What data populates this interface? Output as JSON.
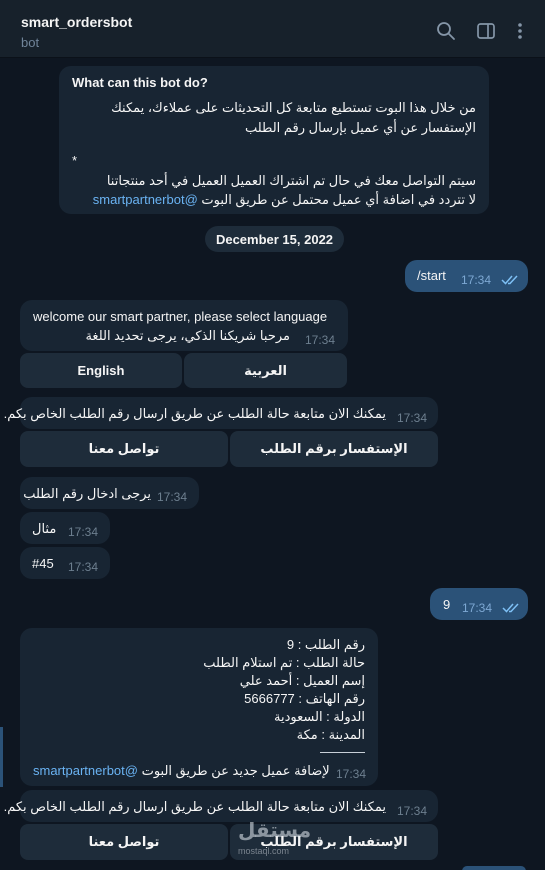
{
  "header": {
    "title": "smart_ordersbot",
    "subtitle": "bot"
  },
  "intro": {
    "heading": "What can this bot do?",
    "line1": "من خلال هذا البوت تستطيع متابعة كل التحديثات على عملاءك، يمكنك",
    "line2": "الإستفسار عن أي عميل بإرسال رقم الطلب",
    "bullet": "*",
    "line3": "سيتم التواصل معك في حال تم اشتراك العميل العميل في أحد منتجاتنا",
    "line4_prefix": "لا تتردد في اضافة أي عميل محتمل عن طريق البوت",
    "line4_link": "@smartpartnerbot"
  },
  "date_separator": "December 15, 2022",
  "messages": {
    "start": {
      "text": "/start",
      "time": "17:34"
    },
    "welcome": {
      "en": "welcome our smart partner, please select language",
      "ar": "مرحبا شريكنا الذكي، يرجى تحديد اللغة",
      "time": "17:34"
    },
    "lang_buttons": {
      "english": "English",
      "arabic": "العربية"
    },
    "follow1": {
      "text": "يمكنك الان متابعة حالة الطلب عن طريق ارسال رقم الطلب الخاص بكم.",
      "time": "17:34"
    },
    "menu1": {
      "contact": "تواصل معنا",
      "inquiry": "الإستفسار برقم الطلب"
    },
    "enter_order": {
      "text": "يرجى ادخال رقم الطلب",
      "time": "17:34"
    },
    "example": {
      "text": "مثال",
      "time": "17:34"
    },
    "example_val": {
      "text": "#45",
      "time": "17:34"
    },
    "user_nine": {
      "text": "9",
      "time": "17:34"
    },
    "order": {
      "l1": "رقم الطلب : 9",
      "l2": "حالة الطلب : تم استلام الطلب",
      "l3": "إسم العميل : أحمد علي",
      "l4": "رقم الهاتف : 5666777",
      "l5": "الدولة : السعودية",
      "l6": "المدينة : مكة",
      "footer_prefix": "لإضافة عميل جديد عن طريق البوت",
      "footer_link": "@smartpartnerbot",
      "time": "17:34"
    },
    "follow2": {
      "text": "يمكنك الان متابعة حالة الطلب عن طريق ارسال رقم الطلب الخاص بكم.",
      "time": "17:34"
    },
    "menu2": {
      "contact": "تواصل معنا",
      "inquiry": "الإستفسار برقم الطلب"
    }
  },
  "watermark": {
    "text": "مستقل",
    "sub": "mostaql.com"
  },
  "colors": {
    "background": "#0e1621",
    "header": "#17212b",
    "incoming": "#182533",
    "outgoing": "#2b5278",
    "link": "#6ab3f3"
  }
}
